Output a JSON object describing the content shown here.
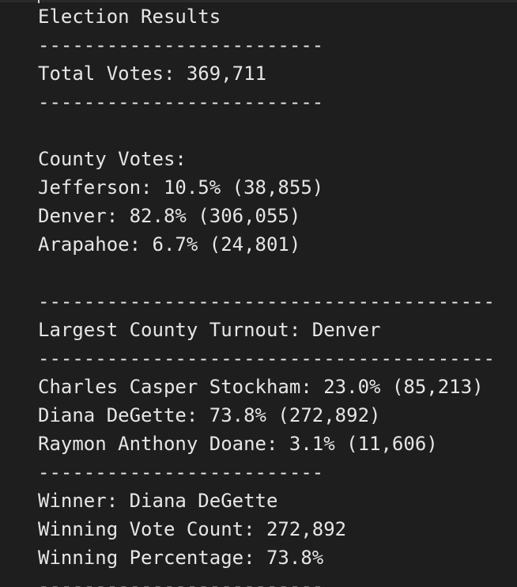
{
  "output": {
    "title": "Election Results",
    "separator_short": "-------------------------",
    "separator_long": "----------------------------------------",
    "total_votes": "Total Votes: 369,711",
    "county_header": "County Votes:",
    "counties": [
      "Jefferson: 10.5% (38,855)",
      "Denver: 82.8% (306,055)",
      "Arapahoe: 6.7% (24,801)"
    ],
    "largest_turnout": "Largest County Turnout: Denver",
    "candidates": [
      "Charles Casper Stockham: 23.0% (85,213)",
      "Diana DeGette: 73.8% (272,892)",
      "Raymon Anthony Doane: 3.1% (11,606)"
    ],
    "winner": "Winner: Diana DeGette",
    "winning_vote_count": "Winning Vote Count: 272,892",
    "winning_percentage": "Winning Percentage: 73.8%"
  }
}
